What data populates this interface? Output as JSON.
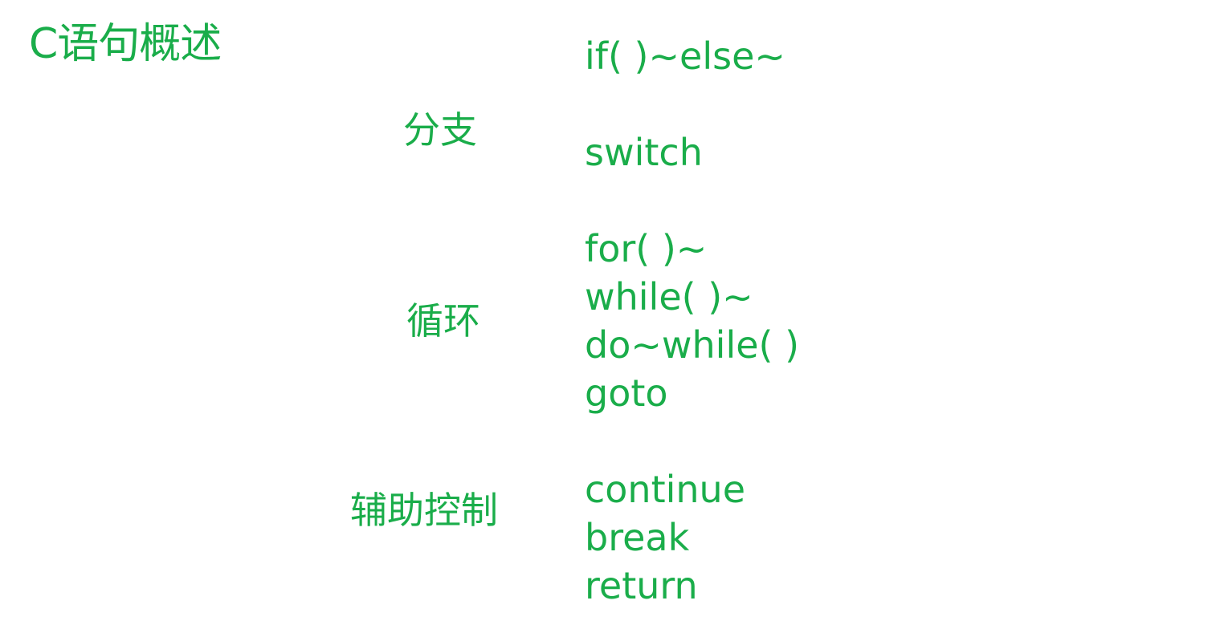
{
  "title": "C语句概述",
  "sections": [
    {
      "category": "分支",
      "statements": [
        "if( )~else~",
        "switch"
      ]
    },
    {
      "category": "循环",
      "statements": [
        "for( )~",
        "while( )~",
        "do~while( )",
        "goto"
      ]
    },
    {
      "category": "辅助控制",
      "statements": [
        "continue",
        "break",
        "return"
      ]
    }
  ],
  "colors": {
    "text": "#1aad4a",
    "background": "#ffffff"
  }
}
